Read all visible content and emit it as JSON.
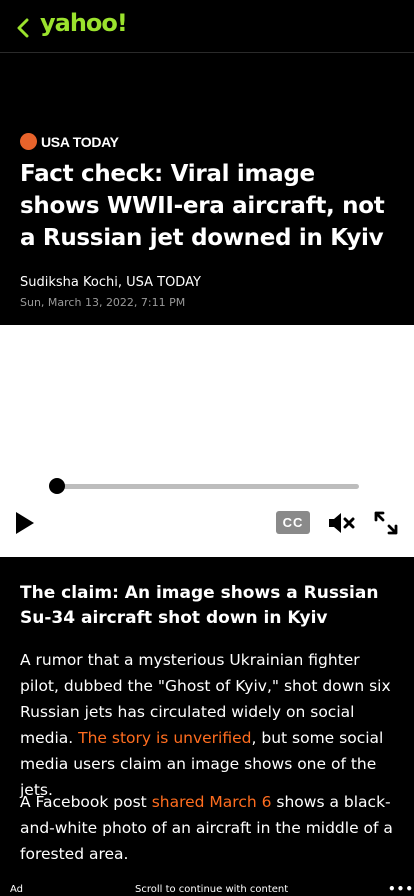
{
  "header": {
    "back_icon": "chevron-left-icon",
    "logo_text": "yahoo!",
    "logo_color": "#9be22d"
  },
  "article": {
    "source": "USA TODAY",
    "source_color": "#e8632b",
    "title": "Fact check: Viral image shows WWII-era aircraft, not a Russian jet downed in Kyiv",
    "author": "Sudiksha Kochi, USA TODAY",
    "date": "Sun, March 13, 2022, 7:11 PM",
    "claim_heading": "The claim: An image shows a Russian Su-34 aircraft shot down in Kyiv",
    "p1_before": "A rumor that a mysterious Ukrainian fighter pilot, dubbed the \"Ghost of Kyiv,\" shot down six Russian jets has circulated widely on social media. ",
    "p1_link": "The story is unverified",
    "p1_after": ", but some social media users claim an image shows one of the jets.",
    "p2_before": "A Facebook post ",
    "p2_link": "shared March 6",
    "p2_after": " shows a black-and-white photo of an aircraft in the middle of a forested area.",
    "link_color": "#ff6d1f"
  },
  "video": {
    "progress_fraction": 0.0,
    "cc_label": "CC",
    "play_icon": "play-icon",
    "mute_icon": "muted-speaker-icon",
    "fullscreen_icon": "fullscreen-icon"
  },
  "footer": {
    "ad_label": "Ad",
    "scroll_label": "Scroll to continue with content",
    "more_label": "•••"
  }
}
